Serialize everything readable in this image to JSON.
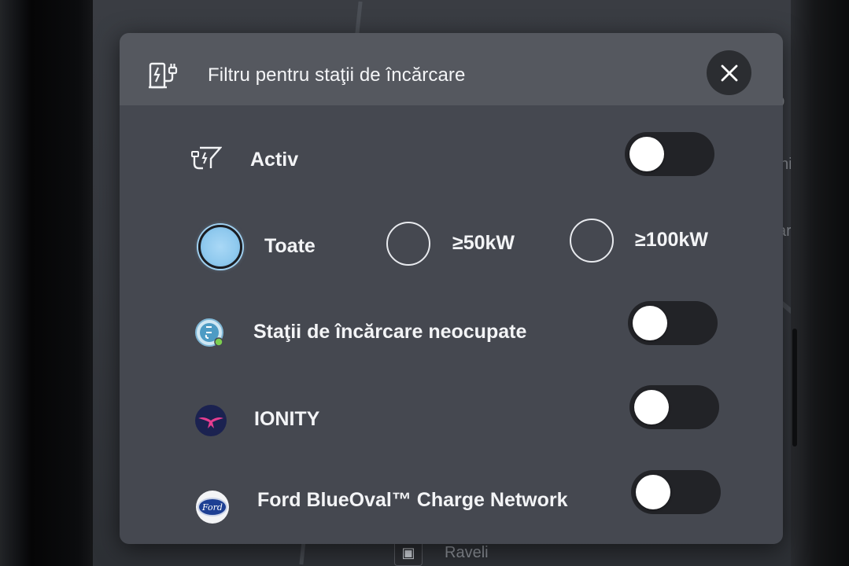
{
  "dialog": {
    "title": "Filtru pentru staţii de încărcare",
    "close_icon": "close-icon",
    "header_icon": "ev-charger-icon"
  },
  "rows": {
    "active": {
      "label": "Activ",
      "icon": "charger-filter-icon",
      "toggle_on": false
    },
    "power": {
      "options": [
        {
          "label": "Toate",
          "selected": true
        },
        {
          "label": "≥50kW",
          "selected": false
        },
        {
          "label": "≥100kW",
          "selected": false
        }
      ]
    },
    "available": {
      "label": "Staţii de încărcare neocupate",
      "icon": "available-charger-icon",
      "toggle_on": false
    },
    "ionity": {
      "label": "IONITY",
      "icon": "ionity-logo-icon",
      "toggle_on": false
    },
    "ford": {
      "label": "Ford BlueOval™ Charge Network",
      "icon": "ford-logo-icon",
      "logo_text": "Ford",
      "toggle_on": false
    }
  },
  "map": {
    "labels": [
      "Raveli",
      "a D",
      "onic",
      "care"
    ]
  },
  "colors": {
    "dialog_bg": "#454850",
    "header_bg": "#55585f",
    "toggle_track": "#222327",
    "radio_selected": "#8fc9ee",
    "ionity_accent": "#e53d8f",
    "ford_blue": "#1d3f93"
  }
}
